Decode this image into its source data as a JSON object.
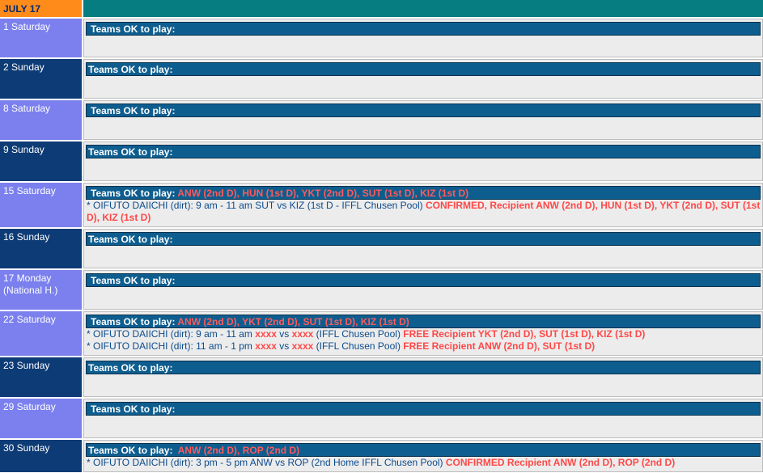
{
  "header": {
    "month": "JULY 17"
  },
  "ok_label": "Teams OK to play:",
  "rows": [
    {
      "date": "1 Saturday",
      "teams": "",
      "matches": []
    },
    {
      "date": "2 Sunday",
      "teams": "",
      "matches": []
    },
    {
      "date": "8 Saturday",
      "teams": "",
      "matches": []
    },
    {
      "date": "9 Sunday",
      "teams": "",
      "matches": []
    },
    {
      "date": "15 Saturday",
      "teams": "ANW (2nd D), HUN (1st D), YKT (2nd D), SUT (1st D), KIZ (1st D)",
      "matches": [
        {
          "text": "* OIFUTO DAIICHI (dirt): 9 am - 11 am SUT vs KIZ (1st D - IFFL Chusen Pool) ",
          "status": "CONFIRMED, Recipient ANW (2nd D), HUN (1st D), YKT (2nd D), SUT (1st D), KIZ (1st D)"
        }
      ]
    },
    {
      "date": "16 Sunday",
      "teams": "",
      "matches": []
    },
    {
      "date": "17 Monday (National H.)",
      "teams": "",
      "matches": []
    },
    {
      "date": "22 Saturday",
      "teams": "ANW (2nd D), YKT (2nd D), SUT (1st D), KIZ (1st D)",
      "matches": [
        {
          "pre": "* OIFUTO DAIICHI (dirt): 9 am - 11 am ",
          "t1": "xxxx",
          "vs": " vs ",
          "t2": "xxxx",
          "post": " (IFFL Chusen Pool) ",
          "status": "FREE Recipient YKT (2nd D), SUT (1st D), KIZ (1st D)"
        },
        {
          "pre": "* OIFUTO DAIICHI (dirt): 11 am - 1 pm ",
          "t1": "xxxx",
          "vs": " vs ",
          "t2": "xxxx",
          "post": " (IFFL Chusen Pool) ",
          "status": "FREE Recipient ANW (2nd D), SUT (1st D)"
        }
      ]
    },
    {
      "date": "23 Sunday",
      "teams": "",
      "matches": []
    },
    {
      "date": "29 Saturday",
      "teams": "",
      "matches": []
    },
    {
      "date": "30 Sunday",
      "teams": "ANW (2nd D), ROP (2nd D)",
      "matches": [
        {
          "text": "* OIFUTO DAIICHI (dirt): 3 pm - 5 pm ANW vs ROP (2nd Home IFFL Chusen Pool) ",
          "status": "CONFIRMED Recipient ANW (2nd D), ROP (2nd D)"
        }
      ]
    }
  ],
  "colors": {
    "month_bg": "#ff8c1a",
    "header_bar": "#067d80",
    "saturday_cell": "#7b80ee",
    "sunday_cell": "#0d3b75",
    "ok_bar": "#0e5d8f",
    "highlight_red": "#ff4848"
  }
}
